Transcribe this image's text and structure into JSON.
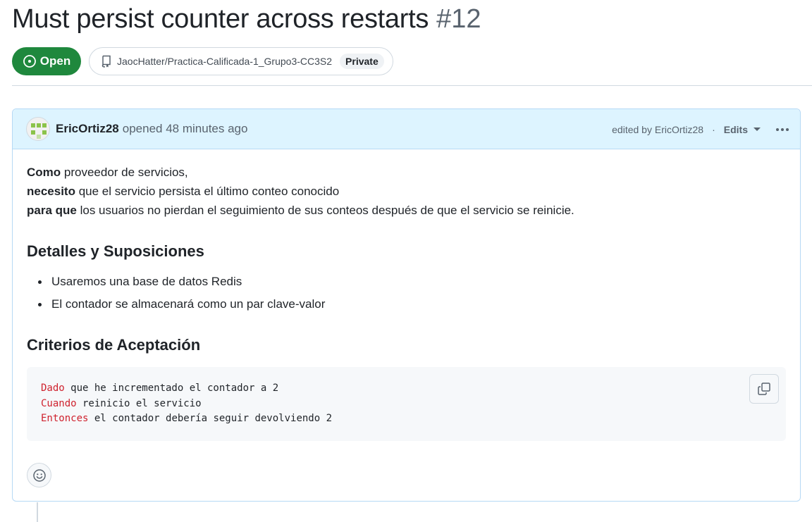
{
  "issue": {
    "title": "Must persist counter across restarts",
    "number": "#12",
    "state_label": "Open",
    "repo": "JaocHatter/Practica-Calificada-1_Grupo3-CC3S2",
    "visibility": "Private"
  },
  "comment": {
    "author": "EricOrtiz28",
    "opened_text": "opened 48 minutes ago",
    "edited_by": "edited by EricOrtiz28",
    "separator": "·",
    "edits_label": "Edits",
    "story": [
      {
        "bold": "Como",
        "rest": " proveedor de servicios,"
      },
      {
        "bold": "necesito",
        "rest": " que el servicio persista el último conteo conocido"
      },
      {
        "bold": "para que",
        "rest": " los usuarios no pierdan el seguimiento de sus conteos después de que el servicio se reinicie."
      }
    ],
    "details_heading": "Detalles y Suposiciones",
    "details_items": [
      "Usaremos una base de datos Redis",
      "El contador se almacenará como un par clave-valor"
    ],
    "criteria_heading": "Criterios de Aceptación",
    "code_lines": [
      {
        "keyword": "Dado",
        "text": " que he incrementado el contador a 2"
      },
      {
        "keyword": "Cuando",
        "text": " reinicio el servicio"
      },
      {
        "keyword": "Entonces",
        "text": " el contador debería seguir devolviendo 2"
      }
    ]
  },
  "colors": {
    "open_green": "#1f883d",
    "header_blue": "#ddf4ff",
    "keyword_red": "#cf222e"
  },
  "icons": [
    "issue-opened-icon",
    "repo-icon",
    "avatar-identicon",
    "caret-down-icon",
    "kebab-icon",
    "copy-icon",
    "smiley-icon"
  ]
}
